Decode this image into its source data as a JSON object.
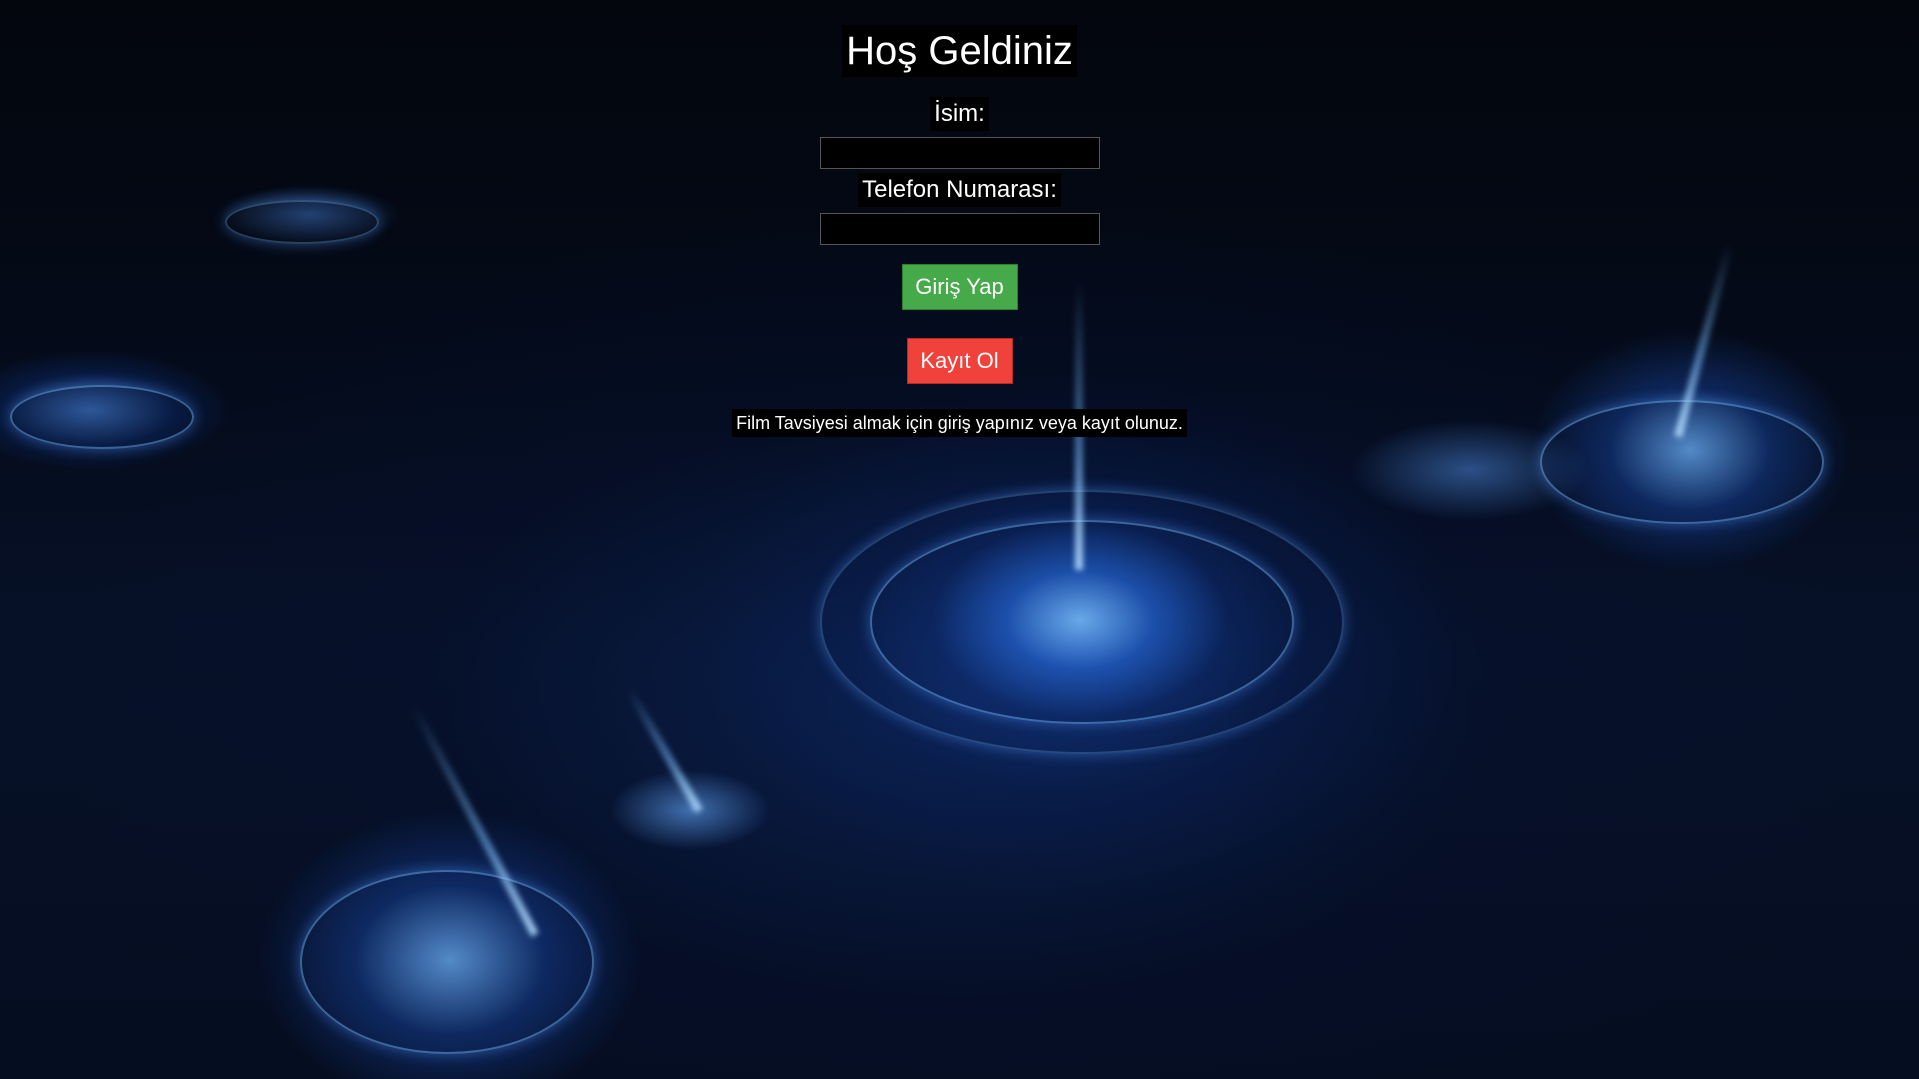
{
  "page": {
    "title": "Hoş Geldiniz"
  },
  "form": {
    "name_label": "İsim:",
    "name_value": "",
    "phone_label": "Telefon Numarası:",
    "phone_value": "",
    "login_button": "Giriş Yap",
    "register_button": "Kayıt Ol",
    "info_text": "Film Tavsiyesi almak için giriş yapınız veya kayıt olunuz."
  },
  "colors": {
    "login_button": "#46a94a",
    "register_button": "#f0413a",
    "label_background": "#000000",
    "text": "#ffffff"
  }
}
